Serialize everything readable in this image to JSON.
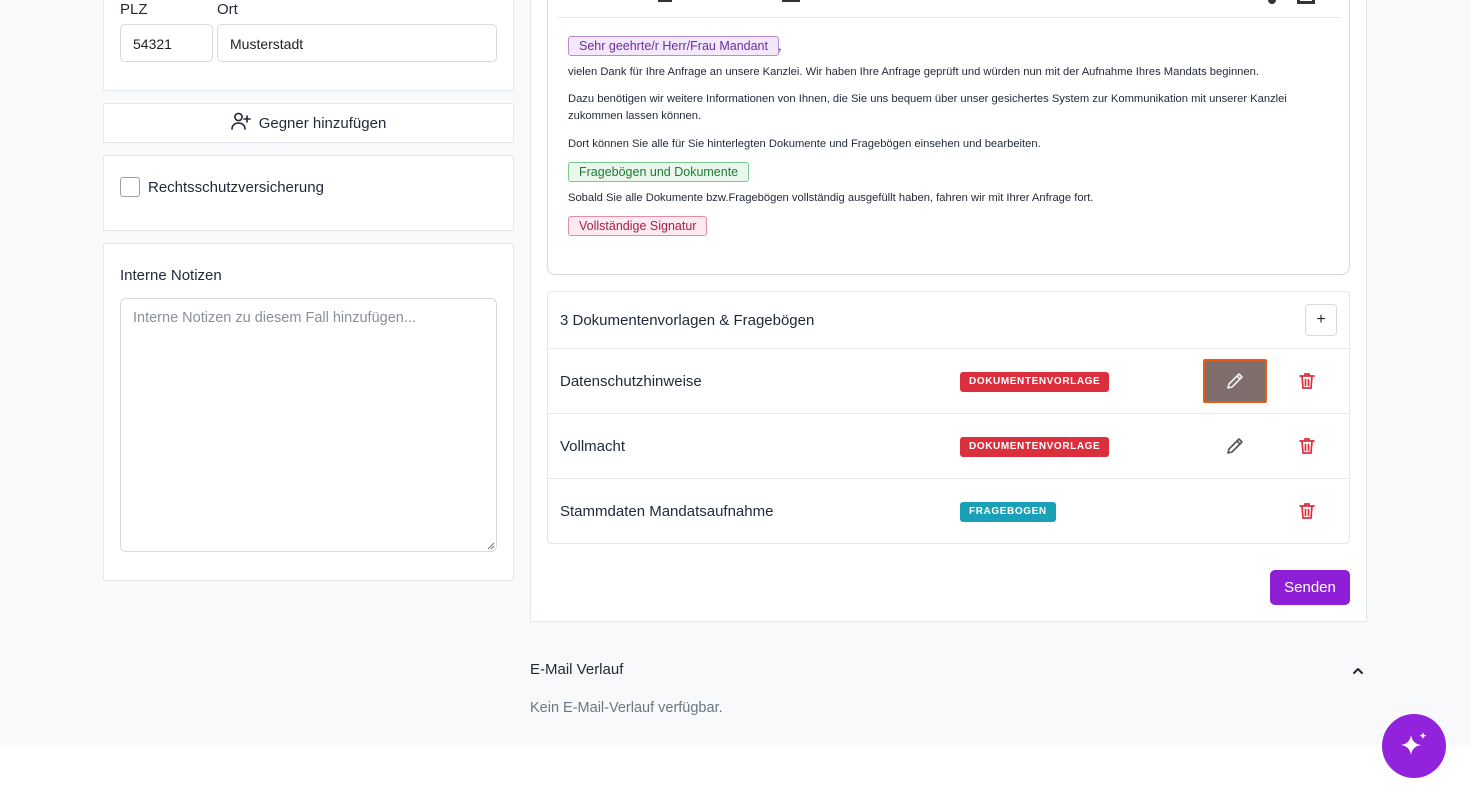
{
  "address": {
    "plz_label": "PLZ",
    "plz_value": "54321",
    "ort_label": "Ort",
    "ort_value": "Musterstadt"
  },
  "gegner_button_label": "Gegner hinzufügen",
  "rechtsschutz_label": "Rechtsschutzversicherung",
  "notes": {
    "label": "Interne Notizen",
    "placeholder": "Interne Notizen zu diesem Fall hinzufügen..."
  },
  "email_body": {
    "salutation_tag": "Sehr geehrte/r Herr/Frau Mandant",
    "salutation_comma": ",",
    "p1": "vielen Dank für Ihre Anfrage an unsere Kanzlei. Wir haben Ihre Anfrage geprüft und würden nun mit der Aufnahme Ihres Mandats beginnen.",
    "p2_line1": "Dazu benötigen wir weitere Informationen von Ihnen, die Sie uns bequem über unser gesichertes System zur Kommunikation mit unserer Kanzlei",
    "p2_line2": "zukommen lassen können.",
    "p3": "Dort können Sie alle für Sie hinterlegten Dokumente und Fragebögen einsehen und bearbeiten.",
    "docs_tag": "Fragebögen und Dokumente",
    "p4": "Sobald Sie alle Dokumente bzw.Fragebögen vollständig ausgefüllt haben, fahren wir mit Ihrer Anfrage fort.",
    "signature_tag": "Vollständige Signatur"
  },
  "documents": {
    "header": "3 Dokumentenvorlagen & Fragebögen",
    "add_label": "+",
    "rows": [
      {
        "name": "Datenschutzhinweise",
        "type": "DOKUMENTENVORLAGE",
        "type_color": "#dc2f3d",
        "editable": true
      },
      {
        "name": "Vollmacht",
        "type": "DOKUMENTENVORLAGE",
        "type_color": "#dc2f3d",
        "editable": true
      },
      {
        "name": "Stammdaten Mandatsaufnahme",
        "type": "FRAGEBOGEN",
        "type_color": "#1aa1b5",
        "editable": false
      }
    ]
  },
  "send_label": "Senden",
  "history": {
    "title": "E-Mail Verlauf",
    "empty": "Kein E-Mail-Verlauf verfügbar."
  },
  "colors": {
    "accent": "#8e1fd6",
    "danger": "#dc2f3d",
    "focus_outline": "#e85d14"
  },
  "icons": {
    "gegner": "user-plus-icon",
    "edit": "pencil-icon",
    "delete": "trash-icon",
    "collapse": "chevron-up-icon",
    "assistant": "sparkles-icon"
  }
}
